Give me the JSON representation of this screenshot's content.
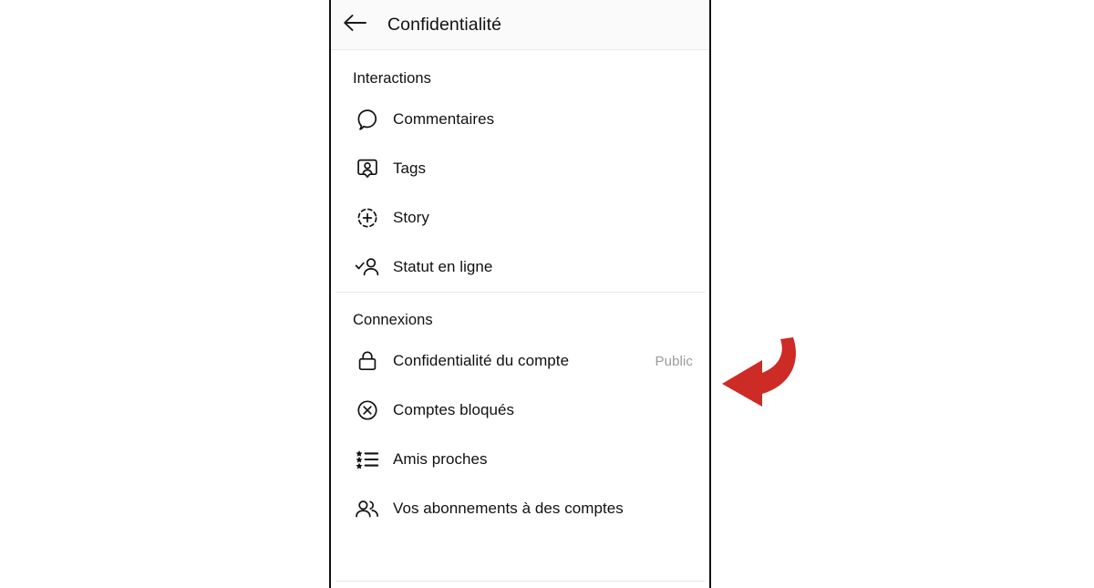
{
  "header": {
    "title": "Confidentialité",
    "back_icon": "arrow-left-icon"
  },
  "sections": [
    {
      "title": "Interactions",
      "items": [
        {
          "label": "Commentaires",
          "icon": "comment-bubble-icon",
          "value": ""
        },
        {
          "label": "Tags",
          "icon": "tag-person-icon",
          "value": ""
        },
        {
          "label": "Story",
          "icon": "story-plus-circle-icon",
          "value": ""
        },
        {
          "label": "Statut en ligne",
          "icon": "person-check-icon",
          "value": ""
        }
      ]
    },
    {
      "title": "Connexions",
      "items": [
        {
          "label": "Confidentialité du compte",
          "icon": "lock-icon",
          "value": "Public"
        },
        {
          "label": "Comptes bloqués",
          "icon": "circle-x-icon",
          "value": ""
        },
        {
          "label": "Amis proches",
          "icon": "star-list-icon",
          "value": ""
        },
        {
          "label": "Vos abonnements à des comptes",
          "icon": "people-icon",
          "value": ""
        }
      ]
    }
  ],
  "annotation": {
    "type": "curved-arrow-left",
    "color": "#cc2b26",
    "points_at": "Public"
  },
  "colors": {
    "text_primary": "#111111",
    "text_muted": "#9b9b9b",
    "header_bg": "#fafafa",
    "divider": "#e6e6e6",
    "frame_border": "#111111",
    "annotation_red": "#cc2b26"
  }
}
